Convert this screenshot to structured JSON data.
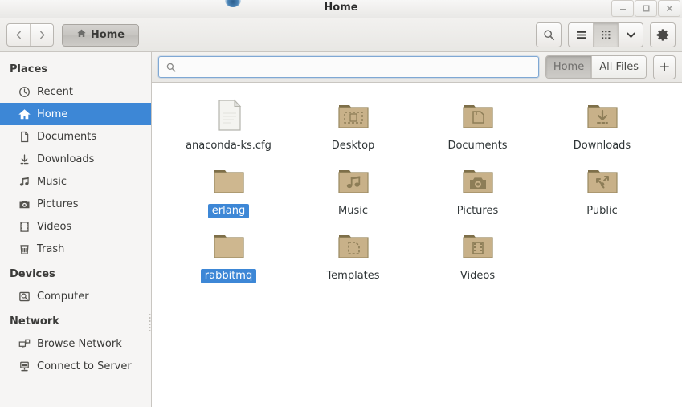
{
  "window": {
    "title": "Home",
    "controls": [
      {
        "name": "minimize-button",
        "glyph": "minimize"
      },
      {
        "name": "maximize-button",
        "glyph": "maximize"
      },
      {
        "name": "close-button",
        "glyph": "close"
      }
    ]
  },
  "toolbar": {
    "back_label": "‹",
    "forward_label": "›",
    "breadcrumbs": [
      {
        "label": "Home",
        "icon": "home-icon",
        "active": true
      }
    ],
    "search_button_icon": "search-icon",
    "view_buttons": [
      {
        "name": "list-view-button",
        "icon": "list-view-icon",
        "active": false
      },
      {
        "name": "grid-view-button",
        "icon": "grid-view-icon",
        "active": true
      },
      {
        "name": "view-options-button",
        "icon": "chevron-down-icon",
        "active": false
      }
    ],
    "settings_icon": "gear-icon"
  },
  "search": {
    "value": "",
    "placeholder": "",
    "icon": "search-icon",
    "scopes": [
      {
        "label": "Home",
        "pressed": true
      },
      {
        "label": "All Files",
        "pressed": false
      }
    ],
    "add_label": "+"
  },
  "sidebar": {
    "sections": [
      {
        "title": "Places",
        "items": [
          {
            "label": "Recent",
            "icon": "clock-icon",
            "selected": false
          },
          {
            "label": "Home",
            "icon": "home-icon",
            "selected": true
          },
          {
            "label": "Documents",
            "icon": "document-icon",
            "selected": false
          },
          {
            "label": "Downloads",
            "icon": "download-icon",
            "selected": false
          },
          {
            "label": "Music",
            "icon": "music-icon",
            "selected": false
          },
          {
            "label": "Pictures",
            "icon": "camera-icon",
            "selected": false
          },
          {
            "label": "Videos",
            "icon": "film-icon",
            "selected": false
          },
          {
            "label": "Trash",
            "icon": "trash-icon",
            "selected": false
          }
        ]
      },
      {
        "title": "Devices",
        "items": [
          {
            "label": "Computer",
            "icon": "computer-icon",
            "selected": false
          }
        ]
      },
      {
        "title": "Network",
        "items": [
          {
            "label": "Browse Network",
            "icon": "network-icon",
            "selected": false
          },
          {
            "label": "Connect to Server",
            "icon": "server-icon",
            "selected": false
          }
        ]
      }
    ]
  },
  "files": {
    "items": [
      {
        "label": "anaconda-ks.cfg",
        "kind": "file",
        "emblem": "none",
        "selected": false
      },
      {
        "label": "Desktop",
        "kind": "folder",
        "emblem": "desktop",
        "selected": false
      },
      {
        "label": "Documents",
        "kind": "folder",
        "emblem": "documents",
        "selected": false
      },
      {
        "label": "Downloads",
        "kind": "folder",
        "emblem": "downloads",
        "selected": false
      },
      {
        "label": "erlang",
        "kind": "folder",
        "emblem": "none",
        "selected": true
      },
      {
        "label": "Music",
        "kind": "folder",
        "emblem": "music",
        "selected": false
      },
      {
        "label": "Pictures",
        "kind": "folder",
        "emblem": "pictures",
        "selected": false
      },
      {
        "label": "Public",
        "kind": "folder",
        "emblem": "public",
        "selected": false
      },
      {
        "label": "rabbitmq",
        "kind": "folder",
        "emblem": "none",
        "selected": true
      },
      {
        "label": "Templates",
        "kind": "folder",
        "emblem": "templates",
        "selected": false
      },
      {
        "label": "Videos",
        "kind": "folder",
        "emblem": "videos",
        "selected": false
      }
    ]
  },
  "colors": {
    "selection": "#3d87d6",
    "folder": "#c8b189",
    "folder_dark": "#8a7a53",
    "chrome": "#efeeec",
    "sidebar": "#f6f5f4"
  }
}
